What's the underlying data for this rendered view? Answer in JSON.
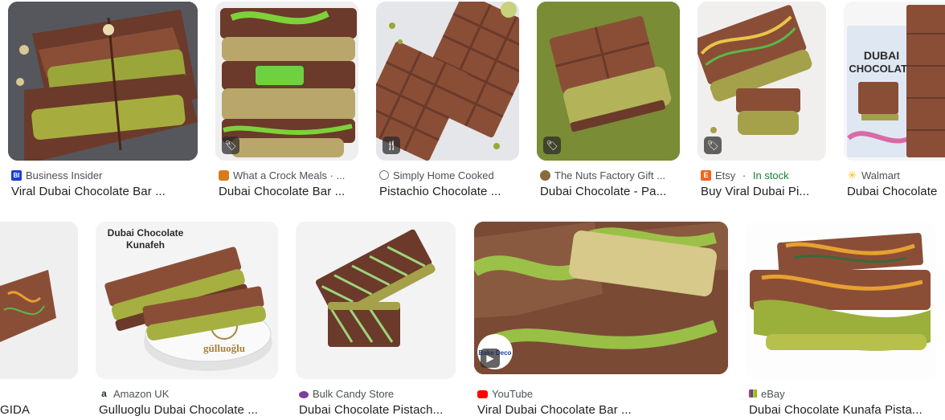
{
  "results": {
    "row1": [
      {
        "source": "Business Insider",
        "title": "Viral Dubai Chocolate Bar ...",
        "favicon": "business-insider-icon",
        "fav_color": "#1a3fd6",
        "badge": "none"
      },
      {
        "source": "What a Crock Meals · ...",
        "title": "Dubai Chocolate Bar ...",
        "favicon": "crock-pot-icon",
        "fav_color": "#d97a1b",
        "badge": "tag"
      },
      {
        "source": "Simply Home Cooked",
        "title": "Pistachio Chocolate ...",
        "favicon": "circle-logo-icon",
        "fav_color": "#9a9a9a",
        "badge": "recipe"
      },
      {
        "source": "The Nuts Factory Gift ...",
        "title": "Dubai Chocolate - Pa...",
        "favicon": "nut-icon",
        "fav_color": "#8a6a3a",
        "badge": "tag"
      },
      {
        "source": "Etsy",
        "stock": "In stock",
        "separator": " · ",
        "title": "Buy Viral Dubai Pi...",
        "favicon": "etsy-icon",
        "fav_color": "#f1641e",
        "badge": "tag"
      },
      {
        "source": "Walmart",
        "title": "Dubai Chocolate",
        "favicon": "walmart-spark-icon",
        "fav_color": "#ffc220",
        "badge": "none"
      }
    ],
    "row2": [
      {
        "source": "",
        "title": "GIDA",
        "favicon": "none",
        "fav_color": "",
        "badge": "none"
      },
      {
        "source": "Amazon UK",
        "title": "Gulluoglu Dubai Chocolate ...",
        "favicon": "amazon-icon",
        "fav_color": "#232f3e",
        "badge": "none",
        "image_caption": "Dubai Chocolate\nKunafeh",
        "image_caption_l1": "Dubai Chocolate",
        "image_caption_l2": "Kunafeh",
        "image_logo_text": "gülluoğlu"
      },
      {
        "source": "Bulk Candy Store",
        "title": "Dubai Chocolate Pistach...",
        "favicon": "bulk-candy-icon",
        "fav_color": "#7b3fa0",
        "badge": "none"
      },
      {
        "source": "YouTube",
        "title": "Viral Dubai Chocolate Bar ...",
        "favicon": "youtube-icon",
        "fav_color": "#ff0000",
        "badge": "play",
        "image_logo_text": "Bake Deco"
      },
      {
        "source": "eBay",
        "title": "Dubai Chocolate Kunafa Pista...",
        "favicon": "ebay-icon",
        "fav_color": "#e53238",
        "badge": "none"
      }
    ]
  },
  "colors": {
    "chocolate": "#6b3a2a",
    "chocolate_light": "#8a4e37",
    "pistachio": "#9aa63a",
    "pistachio_bright": "#7dd13a",
    "olive_bg": "#7a8c35",
    "text_primary": "#202124",
    "text_secondary": "#4d5156",
    "in_stock": "#188038"
  },
  "icons": {
    "tag": "tag-icon",
    "recipe": "fork-knife-icon",
    "play": "play-icon"
  }
}
